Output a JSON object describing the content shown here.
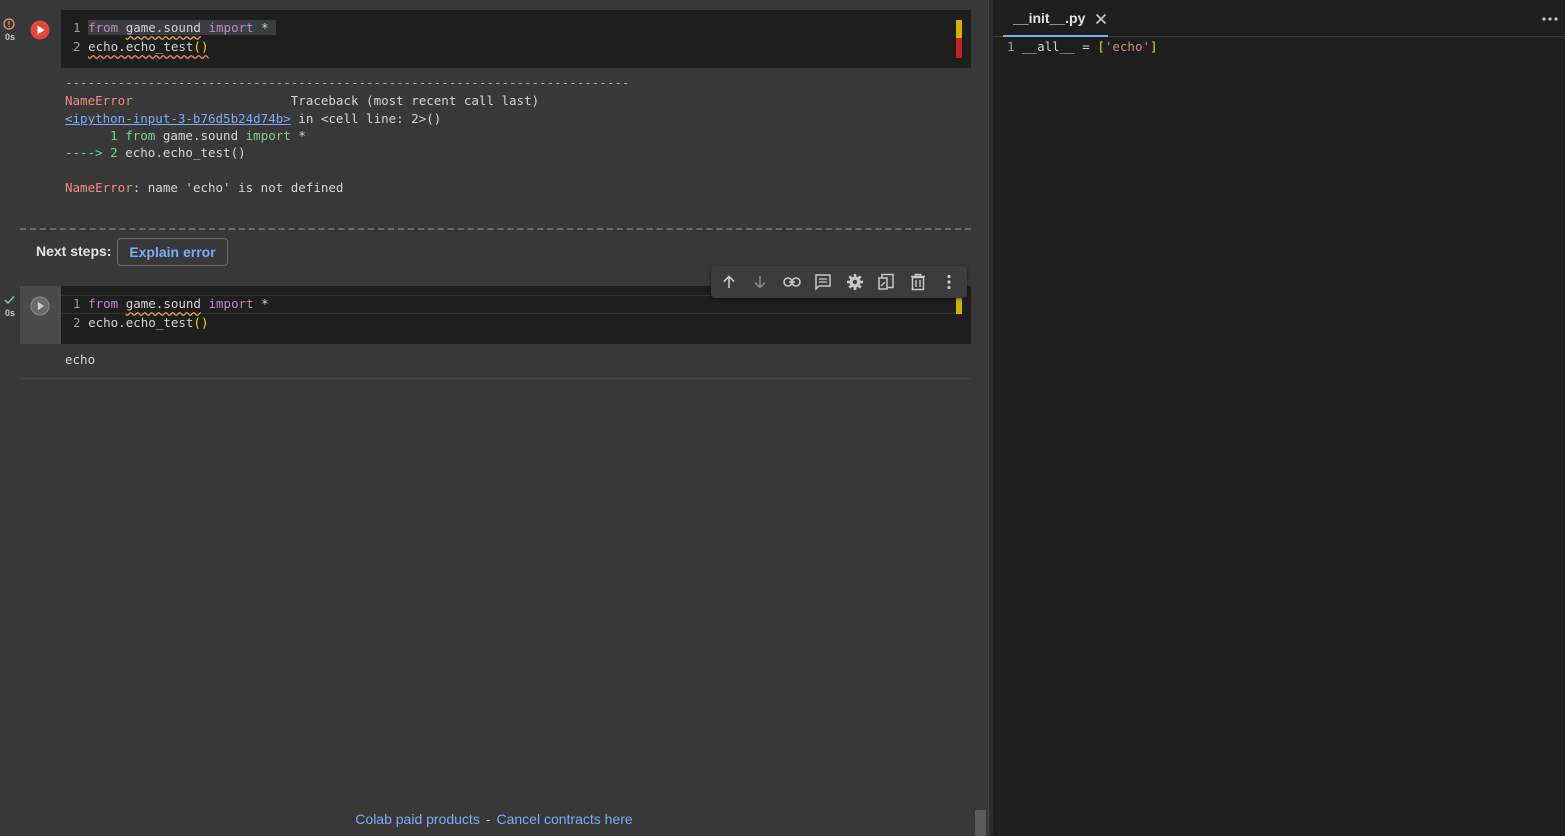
{
  "cell1": {
    "status_time": "0s",
    "code_lines": [
      {
        "num": "1",
        "parts": [
          "from",
          " ",
          "game.sound",
          " ",
          "import",
          " *"
        ]
      },
      {
        "num": "2",
        "parts": [
          "echo.echo_test",
          "()"
        ]
      }
    ],
    "output": {
      "dash_line": "---------------------------------------------------------------------------",
      "error_name": "NameError",
      "traceback_label": "Traceback (most recent call last)",
      "input_link": "<ipython-input-3-b76d5b24d74b>",
      "in_cell_text": " in <cell line: 2>()",
      "tb_line1_num": "      1",
      "tb_line1_from": " from",
      "tb_line1_mod": " game.sound ",
      "tb_line1_import": "import",
      "tb_line1_star": " *",
      "tb_line2_arrow": "----> 2",
      "tb_line2_code": " echo.echo_test()",
      "final_error_name": "NameError",
      "final_error_msg": ": name 'echo' is not defined"
    }
  },
  "next_steps": {
    "label": "Next steps:",
    "button": "Explain error"
  },
  "cell2": {
    "status_time": "0s",
    "code_lines": [
      {
        "num": "1",
        "parts": [
          "from",
          " ",
          "game.sound",
          " ",
          "import",
          " *"
        ]
      },
      {
        "num": "2",
        "parts": [
          "echo.echo_test",
          "()"
        ]
      }
    ],
    "output_text": "echo"
  },
  "toolbar": {
    "icons": [
      "arrow-up-icon",
      "arrow-down-icon",
      "link-icon",
      "comment-icon",
      "gear-icon",
      "mirror-cell-icon",
      "trash-icon",
      "more-vert-icon"
    ]
  },
  "footer": {
    "paid_products": "Colab paid products",
    "separator": "-",
    "cancel_contracts": "Cancel contracts here"
  },
  "editor": {
    "tab_label": "__init__.py",
    "line_num": "1",
    "line_code_a": " __all__ = ",
    "line_bracket_open": "[",
    "line_string": "'echo'",
    "line_bracket_close": "]"
  },
  "colors": {
    "error_red": "#f28b82",
    "link_blue": "#7cacf8",
    "success_green": "#81c995",
    "warning_yellow": "#d4b000",
    "error_marker_red": "#c5221f"
  }
}
